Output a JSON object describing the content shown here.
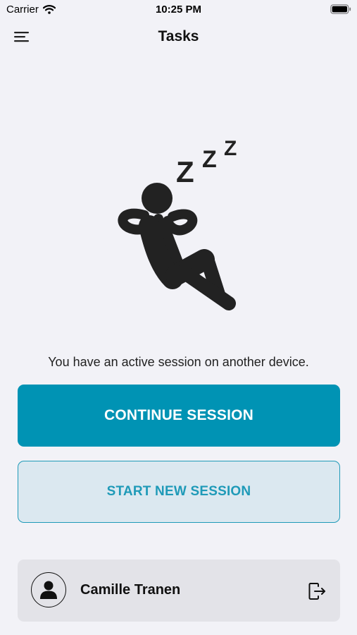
{
  "status_bar": {
    "carrier": "Carrier",
    "time": "10:25 PM",
    "wifi_icon": "wifi-icon",
    "battery_icon": "battery-icon"
  },
  "nav": {
    "title": "Tasks",
    "menu_icon": "hamburger-menu-icon"
  },
  "illustration": {
    "icon": "sleeping-person-icon",
    "sleep_symbol": "Z Z Z"
  },
  "message": "You have an active session on another device.",
  "buttons": {
    "continue_label": "CONTINUE SESSION",
    "start_new_label": "START NEW SESSION"
  },
  "user": {
    "name": "Camille Tranen",
    "avatar_icon": "person-icon",
    "logout_icon": "logout-icon"
  },
  "colors": {
    "background": "#f2f2f7",
    "primary": "#0093b4",
    "secondary_bg": "#dbe8f0",
    "secondary_border": "#1f9ab8",
    "card_bg": "#e3e3e8"
  }
}
